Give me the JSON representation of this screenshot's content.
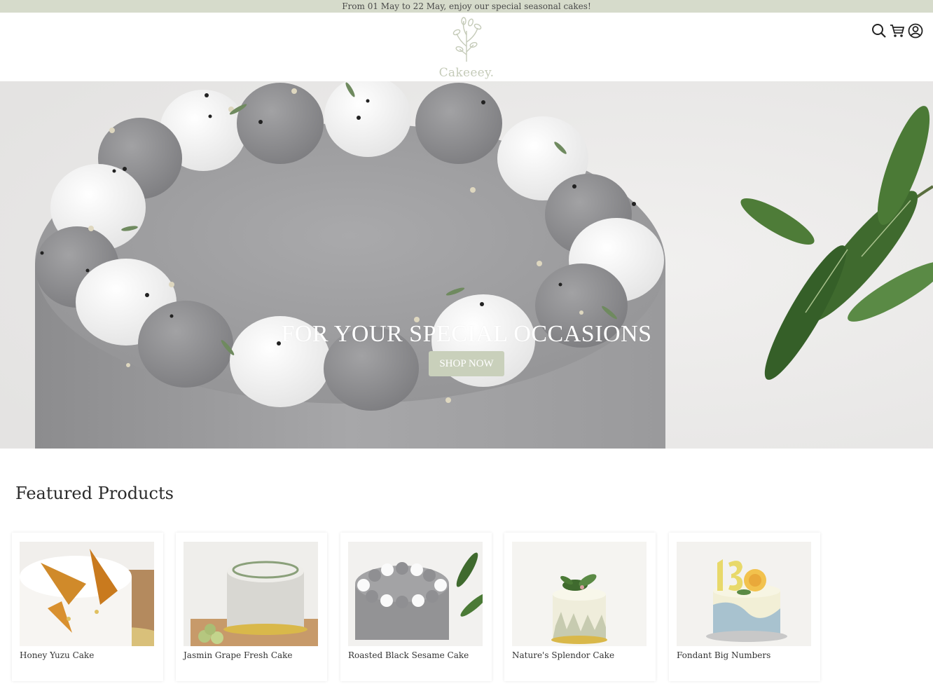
{
  "announcement": "From 01 May to 22 May, enjoy our special seasonal cakes!",
  "header": {
    "logo_text": "Cakeeey.",
    "icons": [
      "search-icon",
      "cart-icon",
      "user-icon"
    ]
  },
  "hero": {
    "title": "FOR YOUR SPECIAL OCCASIONS",
    "button_label": "SHOP NOW"
  },
  "featured": {
    "title": "Featured Products",
    "products": [
      {
        "name": "Honey Yuzu Cake"
      },
      {
        "name": "Jasmin Grape Fresh Cake"
      },
      {
        "name": "Roasted Black Sesame Cake"
      },
      {
        "name": "Nature's Splendor Cake"
      },
      {
        "name": "Fondant Big Numbers"
      }
    ]
  },
  "colors": {
    "announcement_bg": "#d6dbcb",
    "accent": "#c9d0bb",
    "logo": "#c5cbb9"
  }
}
